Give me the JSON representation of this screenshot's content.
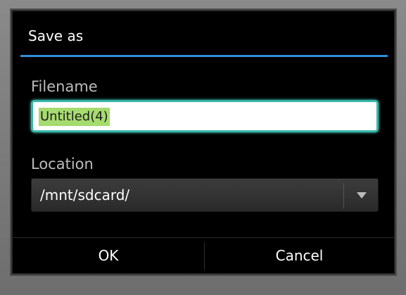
{
  "dialog": {
    "title": "Save as",
    "filename_label": "Filename",
    "filename_value": "Untitled(4)",
    "location_label": "Location",
    "location_value": "/mnt/sdcard/",
    "ok_label": "OK",
    "cancel_label": "Cancel"
  },
  "colors": {
    "title_divider": "#2f8fd8",
    "field_focus_border": "#38b7a9",
    "text_selection": "#a6db6f",
    "dialog_background": "#000000"
  },
  "icons": {
    "spinner_arrow": "chevron-down-icon"
  }
}
